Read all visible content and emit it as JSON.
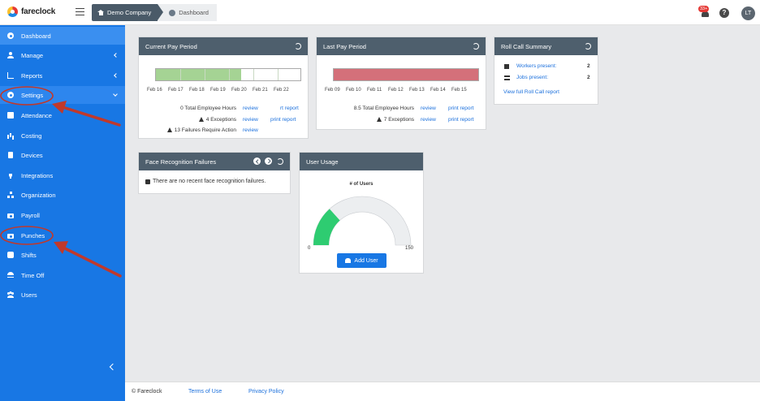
{
  "app": {
    "logo_text": "fareclock"
  },
  "breadcrumb": {
    "company": "Demo Company",
    "page": "Dashboard"
  },
  "topbar": {
    "notifications_badge": "33+",
    "help_label": "?",
    "avatar_initials": "LT"
  },
  "sidebar": {
    "items": [
      {
        "label": "Dashboard",
        "icon": "gauge-icon"
      },
      {
        "label": "Manage",
        "icon": "person-icon"
      },
      {
        "label": "Reports",
        "icon": "chart-icon"
      },
      {
        "label": "Settings",
        "icon": "gear-icon"
      },
      {
        "label": "Attendance",
        "icon": "calendar-icon"
      },
      {
        "label": "Costing",
        "icon": "bar-chart-icon"
      },
      {
        "label": "Devices",
        "icon": "tablet-icon"
      },
      {
        "label": "Integrations",
        "icon": "plug-icon"
      },
      {
        "label": "Organization",
        "icon": "org-chart-icon"
      },
      {
        "label": "Payroll",
        "icon": "money-icon"
      },
      {
        "label": "Punches",
        "icon": "punch-icon"
      },
      {
        "label": "Shifts",
        "icon": "schedule-icon"
      },
      {
        "label": "Time Off",
        "icon": "umbrella-beach-icon"
      },
      {
        "label": "Users",
        "icon": "users-icon"
      }
    ],
    "collapse_label": "‹"
  },
  "current_pay_period": {
    "title": "Current Pay Period",
    "progress_fraction": 0.59,
    "bar_color": "#a5d394",
    "ticks": [
      "Feb 16",
      "Feb 17",
      "Feb 18",
      "Feb 19",
      "Feb 20",
      "Feb 21",
      "Feb 22"
    ],
    "hours_text": "0 Total Employee Hours",
    "hours_review": "review",
    "hours_report": "rt report",
    "exceptions_text": "4 Exceptions",
    "exceptions_review": "review",
    "exceptions_report": "print report",
    "failures_text": "13 Failures Require Action",
    "failures_review": "review"
  },
  "last_pay_period": {
    "title": "Last Pay Period",
    "progress_fraction": 1.0,
    "bar_color": "#d4707a",
    "ticks": [
      "Feb 09",
      "Feb 10",
      "Feb 11",
      "Feb 12",
      "Feb 13",
      "Feb 14",
      "Feb 15"
    ],
    "hours_text": "8.5 Total Employee Hours",
    "hours_review": "review",
    "hours_report": "print report",
    "exceptions_text": "7 Exceptions",
    "exceptions_review": "review",
    "exceptions_report": "print report"
  },
  "roll_call": {
    "title": "Roll Call Summary",
    "workers_label": "Workers present:",
    "workers_count": "2",
    "jobs_label": "Jobs present:",
    "jobs_count": "2",
    "full_report_link": "View full Roll Call report"
  },
  "face_recognition": {
    "title": "Face Recognition Failures",
    "message": "There are no recent face recognition failures."
  },
  "user_usage": {
    "title": "User Usage",
    "gauge_title": "# of Users",
    "gauge_min": "0",
    "gauge_max": "150",
    "gauge_value": 40,
    "gauge_max_value": 150,
    "gauge_color": "#2ecc71",
    "add_user_label": "Add User"
  },
  "footer": {
    "copyright": "© Fareclock",
    "terms": "Terms of Use",
    "privacy": "Privacy Policy"
  },
  "colors": {
    "sidebar_bg": "#1877e4",
    "card_header": "#4e5f6d",
    "link": "#1a6fdc",
    "annotation": "#c0392b"
  }
}
